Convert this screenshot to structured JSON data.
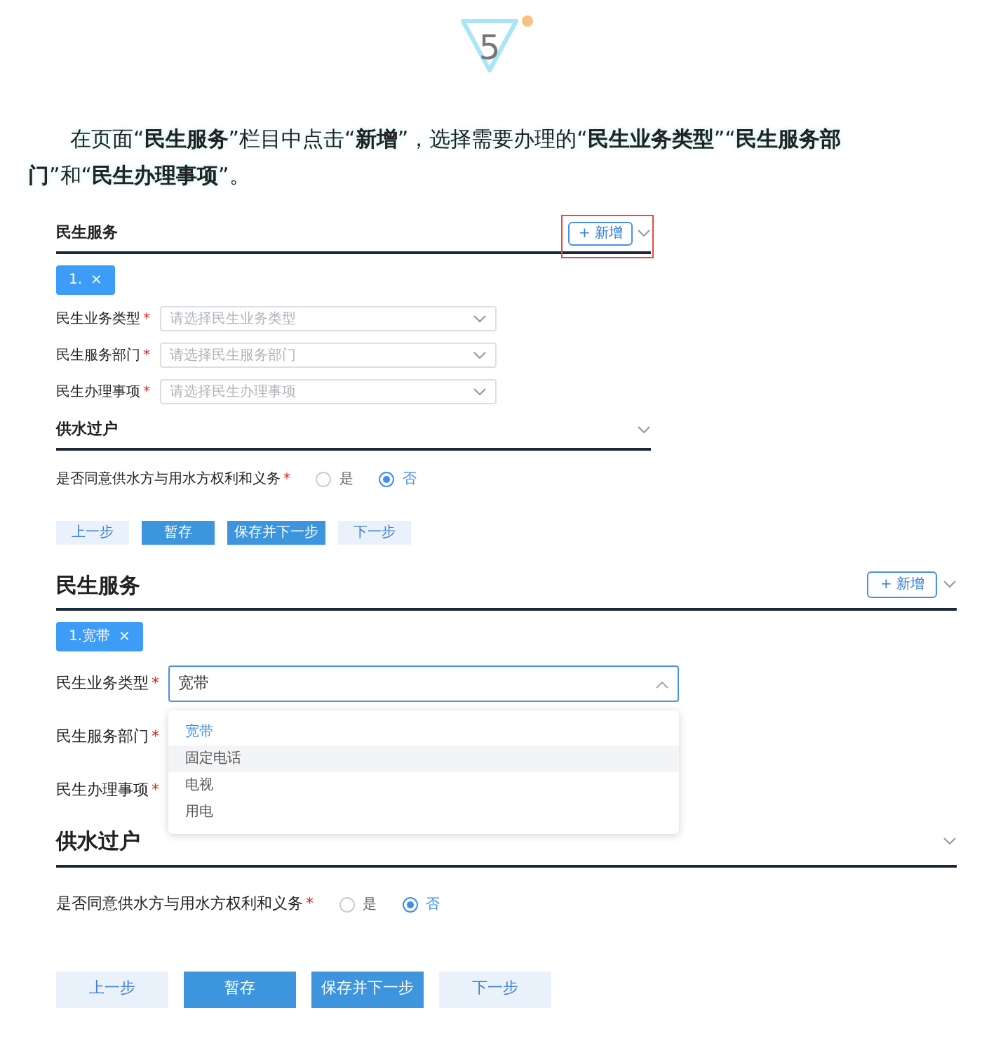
{
  "step": {
    "number": "5"
  },
  "instruction": "在页面“**民生服务**”栏目中点击“**新增**”，选择需要办理的“**民生业务类型**”“**民生服务部门**”和“**民生办理事项**”。",
  "screenshots": [
    {
      "sections": [
        {
          "title": "民生服务",
          "add_button": {
            "label": "+ 新增",
            "highlighted": true
          },
          "tabs": [
            {
              "label": "1.",
              "close": "×",
              "selected": true
            }
          ],
          "fields": [
            {
              "kind": "select",
              "label": "民生业务类型",
              "mark": "*",
              "placeholder": "请选择民生业务类型"
            },
            {
              "kind": "select",
              "label": "民生服务部门",
              "mark": "*",
              "placeholder": "请选择民生服务部门"
            },
            {
              "kind": "select",
              "label": "民生办理事项",
              "mark": "*",
              "placeholder": "请选择民生办理事项"
            }
          ]
        },
        {
          "title": "供水过户",
          "fields": [
            {
              "kind": "radio",
              "label": "是否同意供水方与用水方权利和义务",
              "mark": "*",
              "options": [
                {
                  "label": "是",
                  "selected": false
                },
                {
                  "label": "否",
                  "selected": true
                }
              ]
            }
          ]
        }
      ],
      "buttons": [
        {
          "label": "上一步",
          "primary": false
        },
        {
          "label": "暂存",
          "primary": true
        },
        {
          "label": "保存并下一步",
          "primary": true
        },
        {
          "label": "下一步",
          "primary": false
        }
      ]
    },
    {
      "sections": [
        {
          "title": "民生服务",
          "add_button": {
            "label": "+ 新增"
          },
          "tabs": [
            {
              "label": "1.宽带",
              "close": "×",
              "selected": true
            }
          ],
          "fields": [
            {
              "kind": "select",
              "label": "民生业务类型",
              "mark": "*",
              "value": "宽带",
              "open": true,
              "options": [
                {
                  "label": "宽带",
                  "selected": true,
                  "hovered": false
                },
                {
                  "label": "固定电话",
                  "selected": false,
                  "hovered": true
                },
                {
                  "label": "电视",
                  "selected": false,
                  "hovered": false
                },
                {
                  "label": "用电",
                  "selected": false,
                  "hovered": false
                }
              ]
            },
            {
              "kind": "select",
              "label": "民生服务部门",
              "mark": "*"
            },
            {
              "kind": "select",
              "label": "民生办理事项",
              "mark": "*"
            }
          ]
        },
        {
          "title": "供水过户",
          "fields": [
            {
              "kind": "radio",
              "label": "是否同意供水方与用水方权利和义务",
              "mark": "*",
              "options": [
                {
                  "label": "是",
                  "selected": false
                },
                {
                  "label": "否",
                  "selected": true
                }
              ]
            }
          ]
        }
      ],
      "buttons": [
        {
          "label": "上一步",
          "primary": false
        },
        {
          "label": "暂存",
          "primary": true
        },
        {
          "label": "保存并下一步",
          "primary": true
        },
        {
          "label": "下一步",
          "primary": false
        }
      ]
    }
  ]
}
